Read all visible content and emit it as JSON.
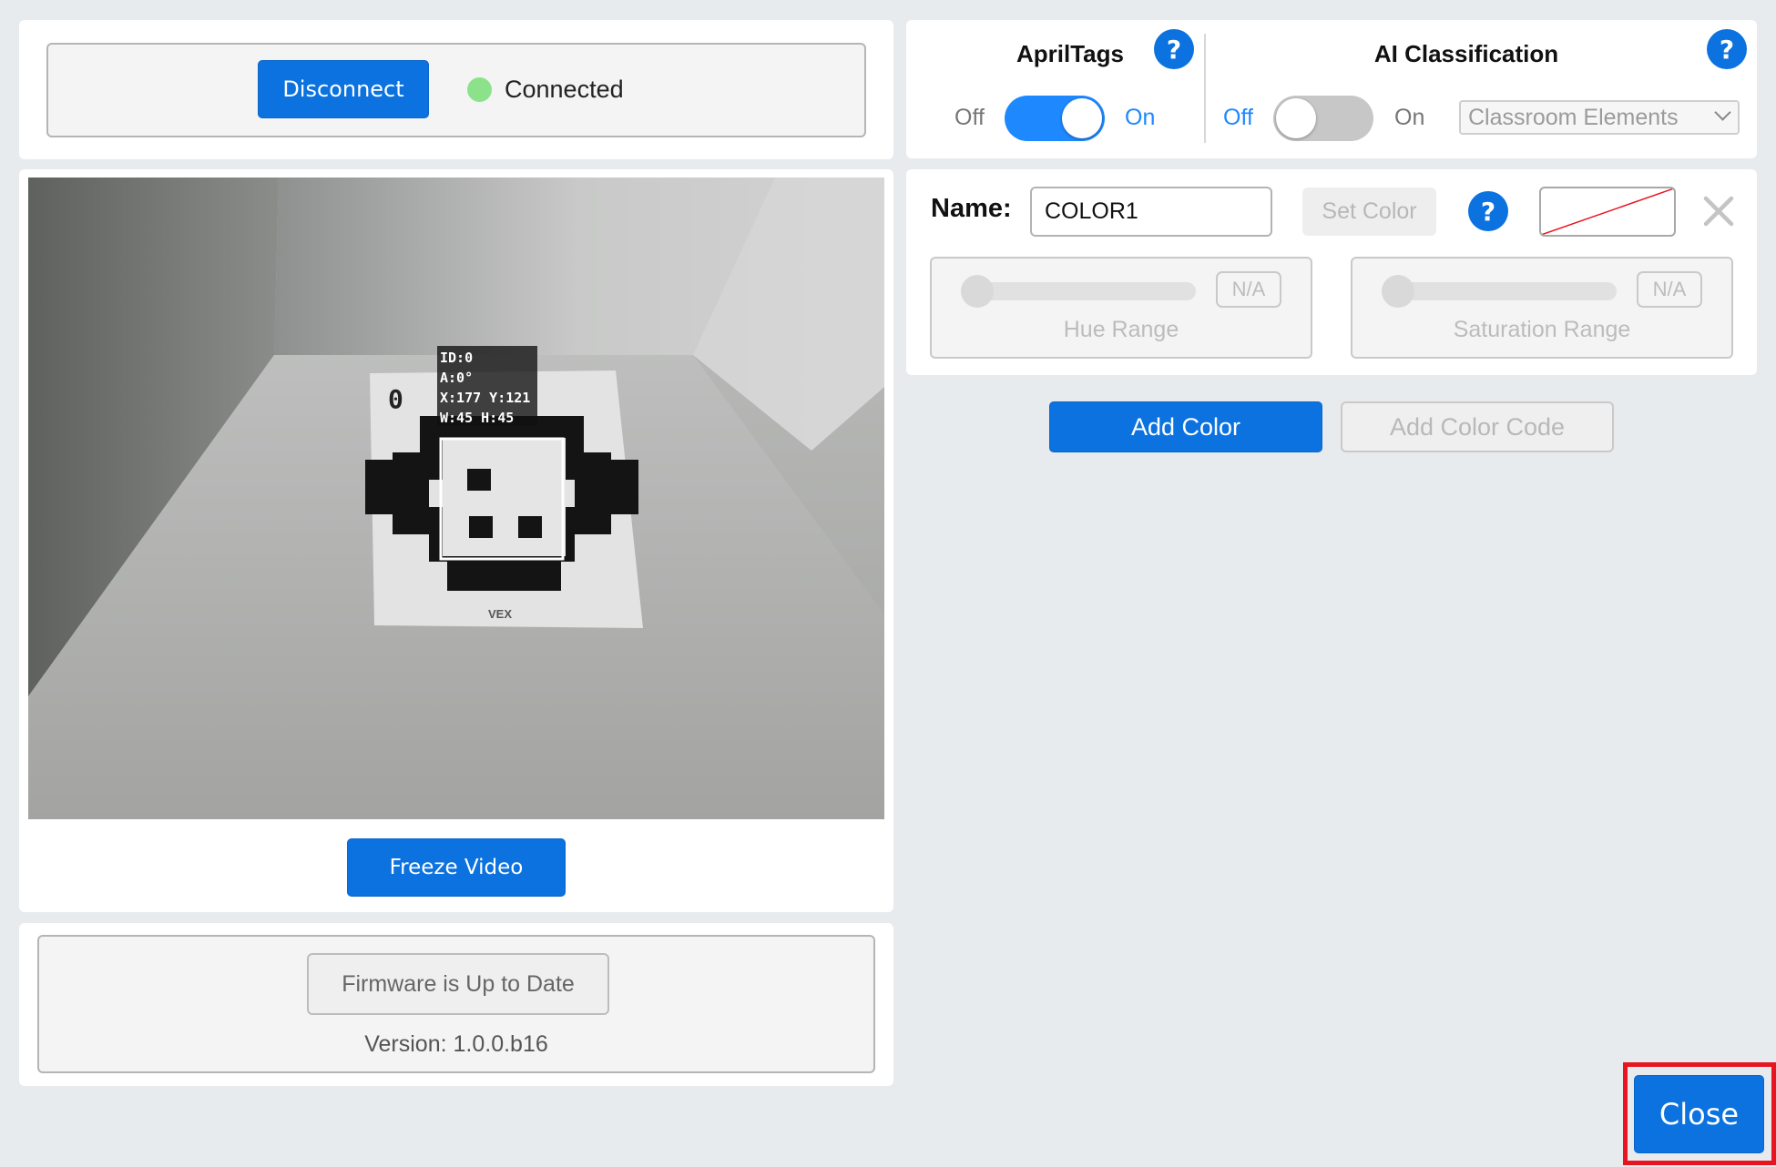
{
  "connection": {
    "disconnect_label": "Disconnect",
    "status_label": "Connected",
    "status_color": "#8ce28a"
  },
  "video": {
    "overlay_lines": [
      "ID:0",
      "A:0°",
      "X:177 Y:121",
      "W:45 H:45"
    ],
    "tag_number": "0",
    "tag_brand": "VEX",
    "freeze_label": "Freeze Video"
  },
  "firmware": {
    "button_label": "Firmware is Up to Date",
    "version_text": "Version: 1.0.0.b16"
  },
  "apriltags": {
    "title": "AprilTags",
    "off_label": "Off",
    "on_label": "On",
    "enabled": true,
    "help": "?"
  },
  "ai_classification": {
    "title": "AI Classification",
    "off_label": "Off",
    "on_label": "On",
    "enabled": false,
    "help": "?",
    "model_selected": "Classroom Elements"
  },
  "color_signature": {
    "name_label": "Name:",
    "name_value": "COLOR1",
    "set_color_label": "Set Color",
    "help": "?",
    "hue": {
      "label": "Hue Range",
      "value": "N/A"
    },
    "saturation": {
      "label": "Saturation Range",
      "value": "N/A"
    }
  },
  "actions": {
    "add_color_label": "Add Color",
    "add_color_code_label": "Add Color Code"
  },
  "footer": {
    "close_label": "Close"
  },
  "colors": {
    "accent": "#0c72df",
    "toggle_on": "#1e88ff",
    "highlight": "#e8141f"
  }
}
